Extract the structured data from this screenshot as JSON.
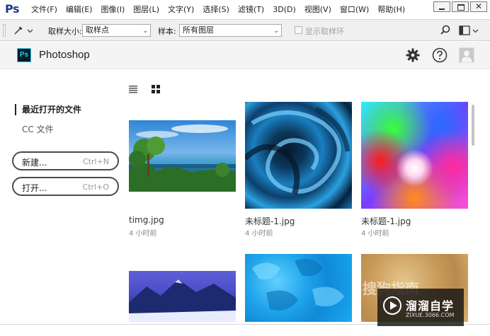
{
  "menubar": {
    "logo": "Ps",
    "items": [
      "文件(F)",
      "编辑(E)",
      "图像(I)",
      "图层(L)",
      "文字(Y)",
      "选择(S)",
      "滤镜(T)",
      "3D(D)",
      "视图(V)",
      "窗口(W)",
      "帮助(H)"
    ],
    "window_controls": {
      "close": "✕"
    }
  },
  "options": {
    "sample_size_label": "取样大小:",
    "sample_size_value": "取样点",
    "sample_label": "样本:",
    "sample_value": "所有图层",
    "show_ring_label": "显示取样环",
    "show_ring_checked": false
  },
  "header": {
    "badge": "Ps",
    "app_name": "Photoshop",
    "icons": [
      "gear-icon",
      "help-icon",
      "user-icon"
    ]
  },
  "sidebar": {
    "recent_title": "最近打开的文件",
    "cc_files": "CC 文件",
    "new_button": {
      "label": "新建...",
      "shortcut": "Ctrl+N"
    },
    "open_button": {
      "label": "打开...",
      "shortcut": "Ctrl+O"
    }
  },
  "files": [
    {
      "name": "timg.jpg",
      "time": "4 小时前"
    },
    {
      "name": "未标题-1.jpg",
      "time": "4 小时前"
    },
    {
      "name": "未标题-1.jpg",
      "time": "4 小时前"
    }
  ],
  "watermark": {
    "title": "溜溜自学",
    "url": "ZIXUE.3066.COM",
    "ghost": "搜狗指南"
  }
}
